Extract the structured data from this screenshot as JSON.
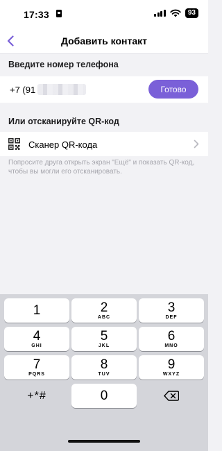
{
  "status_bar": {
    "time": "17:33",
    "battery": "93"
  },
  "nav": {
    "title": "Добавить контакт"
  },
  "phone_section": {
    "header": "Введите номер телефона",
    "prefix": "+7 (91",
    "done_label": "Готово"
  },
  "qr_section": {
    "header": "Или отсканируйте QR-код",
    "scanner_label": "Сканер QR-кода",
    "hint": "Попросите друга открыть экран \"Ещё\" и показать QR-код, чтобы вы могли его отсканировать."
  },
  "keyboard": {
    "keys": [
      {
        "digit": "1",
        "letters": ""
      },
      {
        "digit": "2",
        "letters": "ABC"
      },
      {
        "digit": "3",
        "letters": "DEF"
      },
      {
        "digit": "4",
        "letters": "GHI"
      },
      {
        "digit": "5",
        "letters": "JKL"
      },
      {
        "digit": "6",
        "letters": "MNO"
      },
      {
        "digit": "7",
        "letters": "PQRS"
      },
      {
        "digit": "8",
        "letters": "TUV"
      },
      {
        "digit": "9",
        "letters": "WXYZ"
      }
    ],
    "symbols": "+*#",
    "zero": "0"
  },
  "colors": {
    "accent": "#7a60d8",
    "background": "#f2f2f5",
    "keyboard_bg": "#d4d5da",
    "hint": "#a6a6ad"
  },
  "icons": [
    "back-chevron-icon",
    "qr-code-icon",
    "chevron-right-icon",
    "backspace-icon",
    "signal-icon",
    "wifi-icon",
    "person-card-icon"
  ]
}
